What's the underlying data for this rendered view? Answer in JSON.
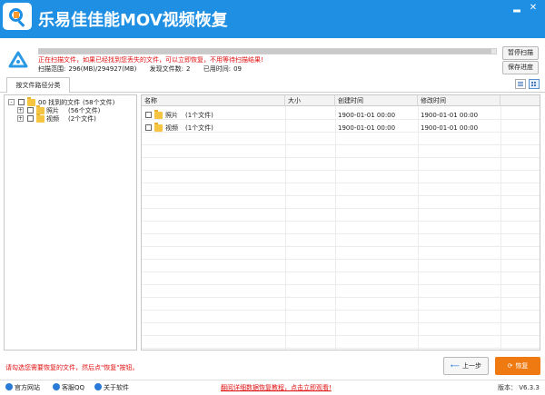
{
  "window": {
    "title": "乐易佳佳能MOV视频恢复",
    "minimize_glyph": "▂",
    "close_glyph": "✕"
  },
  "status": {
    "scan_message": "正在扫描文件，如果已经找到您丢失的文件，可以立即恢复，不用等待扫描结果!",
    "scan_range_label": "扫描范围:",
    "scan_range_value": "296(MB)/294927(MB)",
    "found_label": "发现文件数:",
    "found_value": "2",
    "elapsed_label": "已用时间:",
    "elapsed_value": "09",
    "progress_fraction": 0.99,
    "pause_button": "暂停扫描",
    "save_progress_button": "保存进度"
  },
  "tabs": [
    {
      "label": "按文件路径分类"
    }
  ],
  "tree": {
    "root": {
      "label": "00 找到的文件",
      "count": "(58个文件)",
      "expander": "-"
    },
    "children": [
      {
        "label": "照片",
        "count": "(56个文件)",
        "expander": "+"
      },
      {
        "label": "视频",
        "count": "(2个文件)",
        "expander": "+"
      }
    ]
  },
  "file_list": {
    "columns": [
      "名称",
      "大小",
      "创建时间",
      "修改时间"
    ],
    "rows": [
      {
        "name": "照片",
        "note": "(1个文件)",
        "size": "",
        "created": "1900-01-01  00:00",
        "modified": "1900-01-01  00:00"
      },
      {
        "name": "视频",
        "note": "(1个文件)",
        "size": "",
        "created": "1900-01-01  00:00",
        "modified": "1900-01-01  00:00"
      }
    ]
  },
  "bottom": {
    "hint": "请勾选您需要恢复的文件，然后点\"恢复\"按钮。",
    "back_button": "上一步",
    "back_glyph": "⟵",
    "restore_button": "恢复",
    "restore_glyph": "⟳"
  },
  "footer": {
    "links": [
      "官方网站",
      "客服QQ",
      "关于软件"
    ],
    "tutorial": "翻阅详细数据恢复教程，点击立即观看!",
    "version": "版本： V6.3.3"
  },
  "colors": {
    "title_bar": "#1e8fe2",
    "accent_orange": "#f07a12",
    "warning_red": "#e01010"
  }
}
